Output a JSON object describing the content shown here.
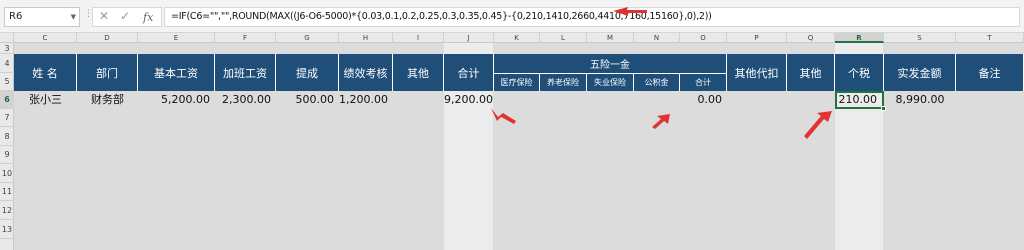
{
  "name_box": "R6",
  "formula": "=IF(C6=\"\",\"\",ROUND(MAX((J6-O6-5000)*{0.03,0.1,0.2,0.25,0.3,0.35,0.45}-{0,210,1410,2660,4410,7160,15160},0),2))",
  "formula_icons": [
    "close-icon",
    "check-icon",
    "fx-icon"
  ],
  "columns": [
    "C",
    "D",
    "E",
    "F",
    "G",
    "H",
    "I",
    "J",
    "K",
    "L",
    "M",
    "N",
    "O",
    "P",
    "Q",
    "R",
    "S",
    "T"
  ],
  "rows": [
    "3",
    "4",
    "5",
    "6",
    "7",
    "8",
    "9",
    "10",
    "11",
    "12",
    "13"
  ],
  "selected": {
    "column": "R",
    "row": "6"
  },
  "headers": {
    "name": "姓  名",
    "dept": "部门",
    "base": "基本工资",
    "overtime": "加班工资",
    "commission": "提成",
    "performance": "绩效考核",
    "other": "其他",
    "total": "合计",
    "insurance_group": "五险一金",
    "medical": "医疗保险",
    "pension": "养老保险",
    "unemployment": "失业保险",
    "housing": "公积金",
    "ins_total": "合计",
    "other_deduct": "其他代扣",
    "other2": "其他",
    "tax": "个税",
    "net": "实发金额",
    "remark": "备注"
  },
  "row6": {
    "name": "张小三",
    "dept": "财务部",
    "base": "5,200.00",
    "overtime": "2,300.00",
    "commission": "500.00",
    "performance": "1,200.00",
    "total": "9,200.00",
    "ins_total": "0.00",
    "tax": "210.00",
    "net": "8,990.00"
  },
  "colors": {
    "header_bg": "#1f4e79",
    "annotation": "#e03434",
    "selection": "#217346"
  }
}
